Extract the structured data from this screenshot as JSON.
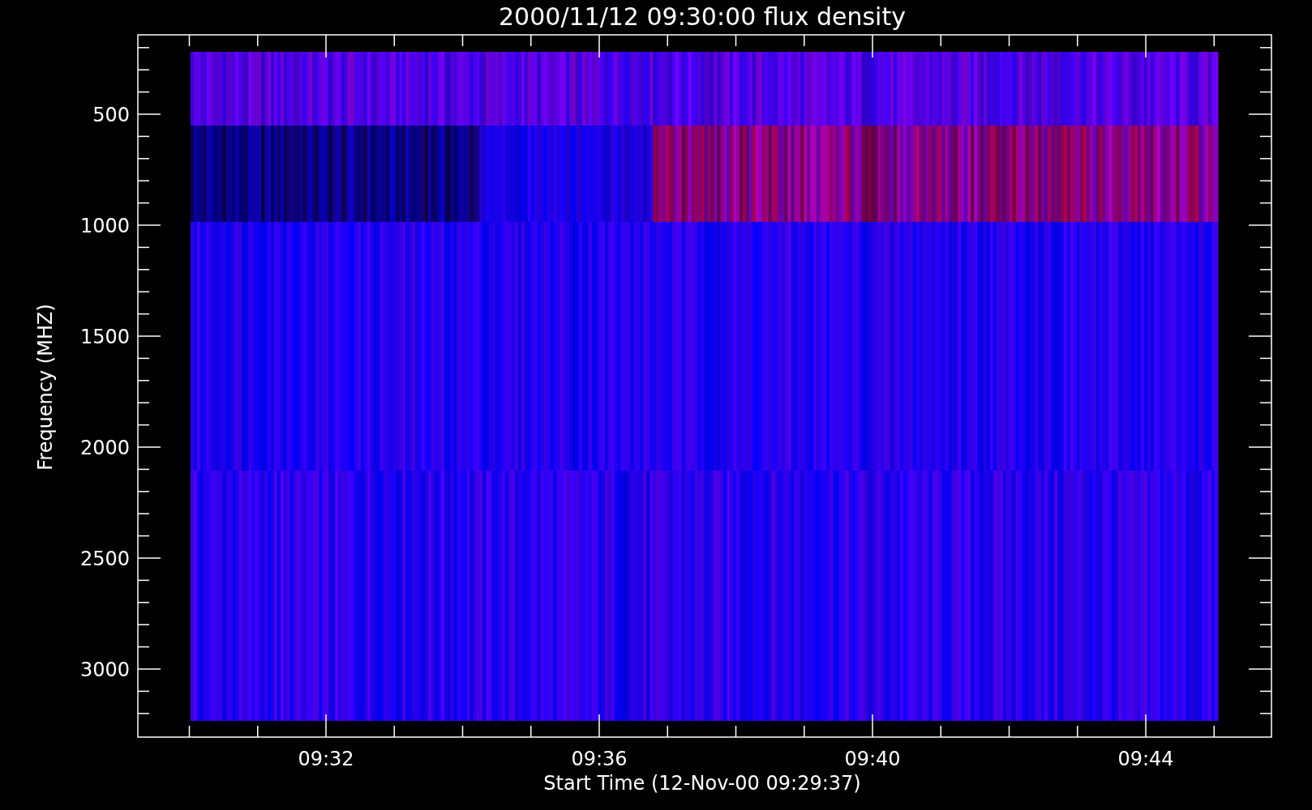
{
  "title": "2000/11/12 09:30:00 flux density",
  "y_axis": {
    "label": "Frequency (MHZ)",
    "ticks": [
      "500",
      "1000",
      "1500",
      "2000",
      "2500",
      "3000"
    ]
  },
  "x_axis": {
    "label": "Start Time (12-Nov-00 09:29:37)",
    "ticks": [
      "09:32",
      "09:36",
      "09:40",
      "09:44"
    ]
  }
}
